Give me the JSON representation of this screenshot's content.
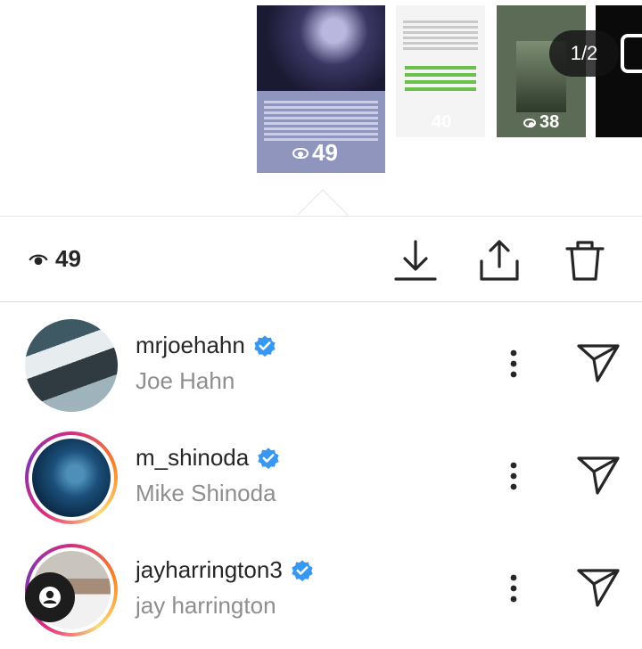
{
  "stories": [
    {
      "views": "49"
    },
    {
      "views": "40"
    },
    {
      "views": "38"
    }
  ],
  "pager": "1/2",
  "stats": {
    "view_count": "49"
  },
  "viewers": [
    {
      "username": "mrjoehahn",
      "fullname": "Joe Hahn",
      "verified": true
    },
    {
      "username": "m_shinoda",
      "fullname": "Mike Shinoda",
      "verified": true
    },
    {
      "username": "jayharrington3",
      "fullname": "jay harrington",
      "verified": true
    }
  ],
  "colors": {
    "verified": "#3897f0",
    "text": "#262626",
    "secondary_text": "#8e8e8e"
  }
}
